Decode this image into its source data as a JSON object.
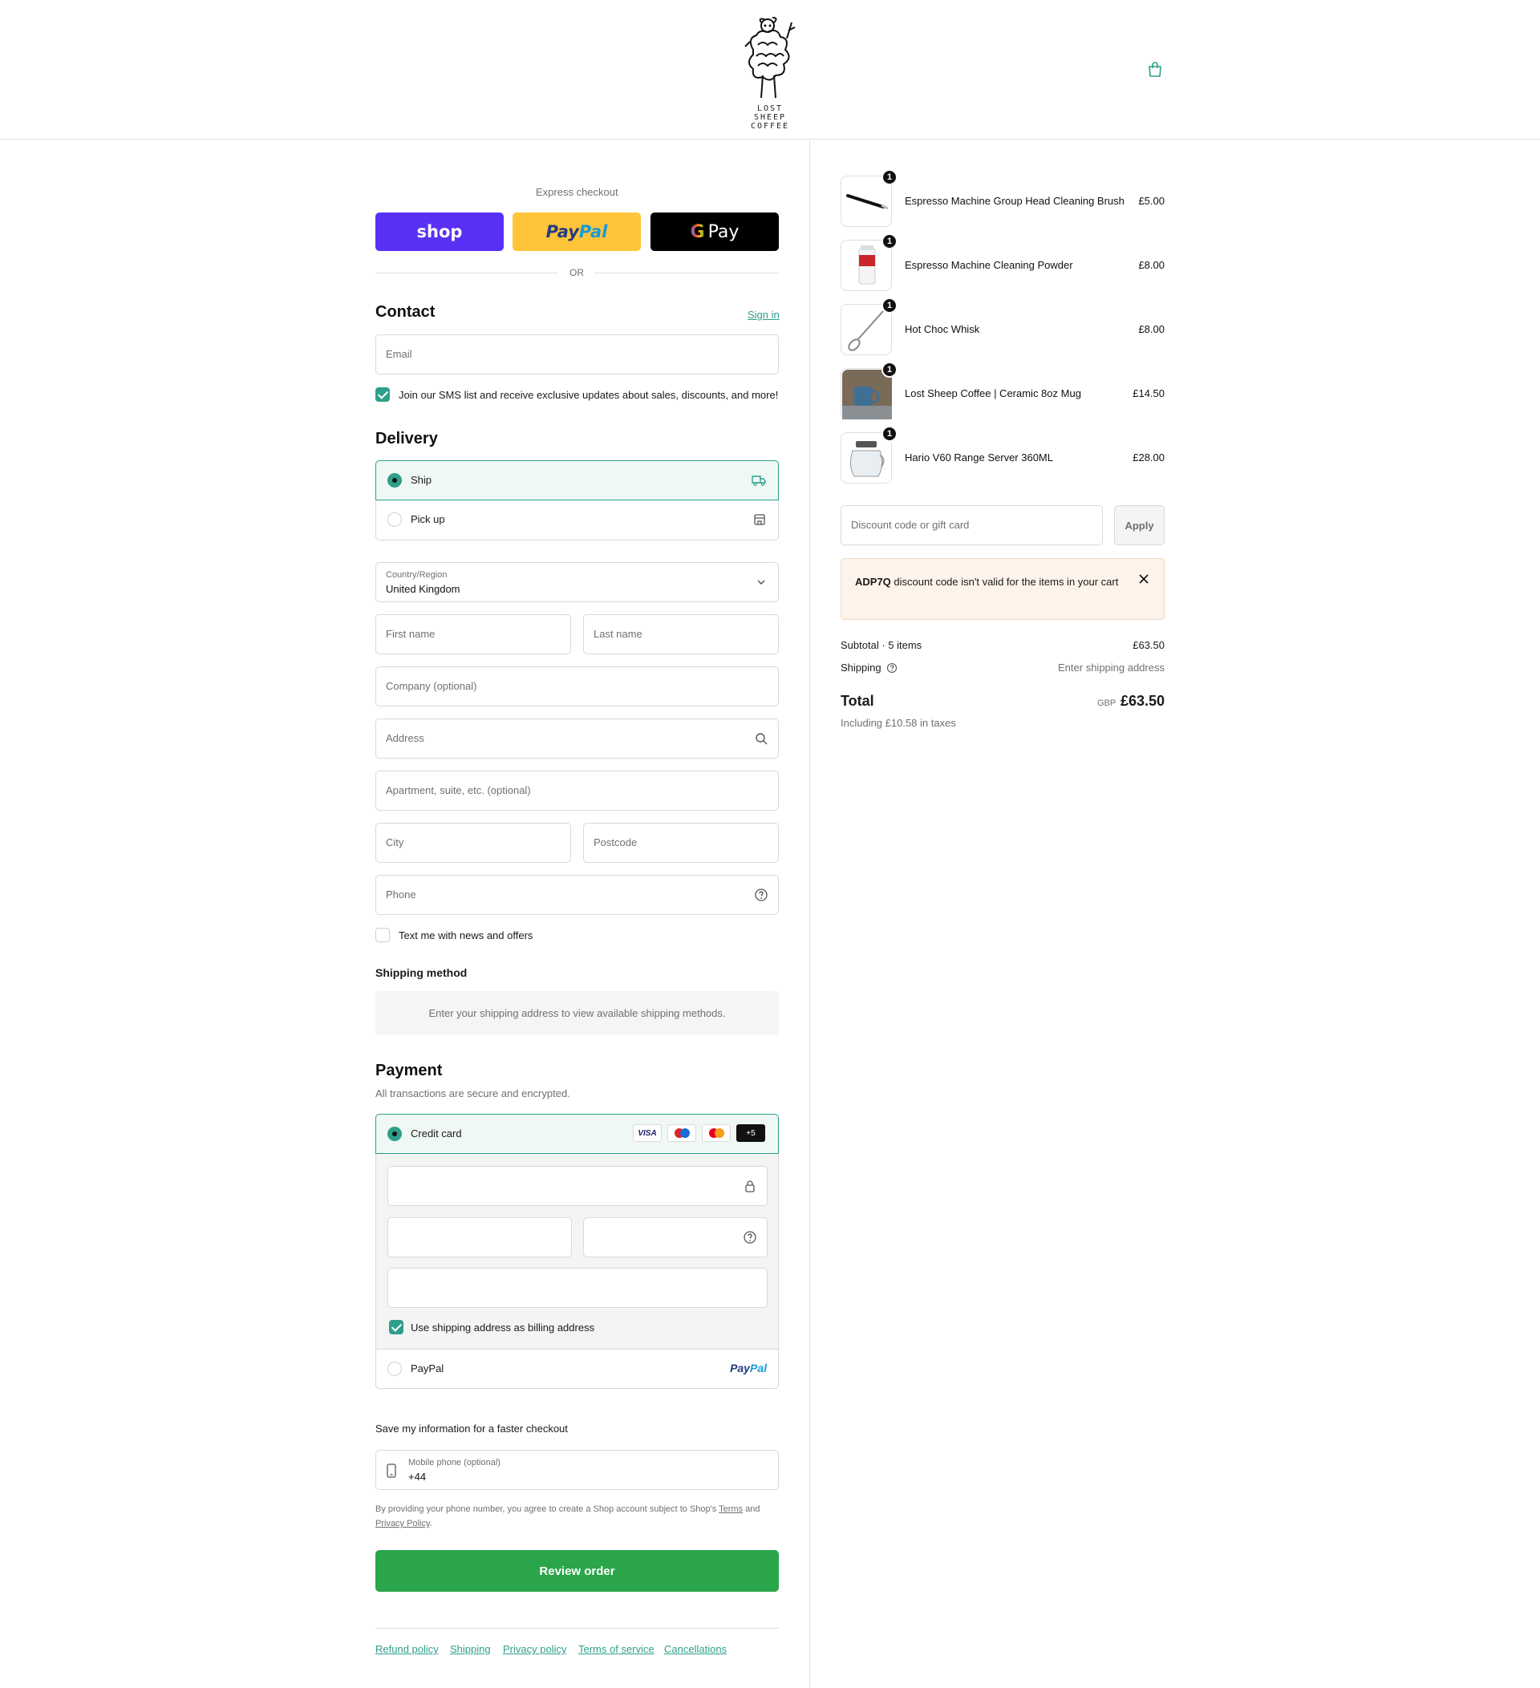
{
  "brand": {
    "logo_line1": "LOST SHEEP",
    "logo_line2": "COFFEE"
  },
  "express": {
    "title": "Express checkout",
    "shop_label": "shop",
    "paypal_part1": "Pay",
    "paypal_part2": "Pal",
    "gpay_label": "Pay",
    "or_label": "OR"
  },
  "contact": {
    "heading": "Contact",
    "sign_in": "Sign in",
    "email_placeholder": "Email",
    "sms_label": "Join our SMS list and receive exclusive updates about sales, discounts, and more!"
  },
  "delivery": {
    "heading": "Delivery",
    "ship_label": "Ship",
    "pickup_label": "Pick up",
    "country_label": "Country/Region",
    "country_value": "United Kingdom",
    "first_name": "First name",
    "last_name": "Last name",
    "company": "Company (optional)",
    "address": "Address",
    "apartment": "Apartment, suite, etc. (optional)",
    "city": "City",
    "postcode": "Postcode",
    "phone": "Phone",
    "text_offers": "Text me with news and offers"
  },
  "shipping_method": {
    "heading": "Shipping method",
    "notice": "Enter your shipping address to view available shipping methods."
  },
  "payment": {
    "heading": "Payment",
    "subtitle": "All transactions are secure and encrypted.",
    "credit_card_label": "Credit card",
    "card_logos": [
      "VISA",
      "maestro",
      "mastercard",
      "+5"
    ],
    "billing_label": "Use shipping address as billing address",
    "paypal_label": "PayPal",
    "paypal_logo_1": "Pay",
    "paypal_logo_2": "Pal"
  },
  "save_info": {
    "title": "Save my information for a faster checkout",
    "mobile_label": "Mobile phone (optional)",
    "mobile_value": "+44",
    "legal_prefix": "By providing your phone number, you agree to create a Shop account subject to Shop's ",
    "terms": "Terms",
    "legal_and": " and",
    "privacy": "Privacy Policy",
    "legal_suffix": "."
  },
  "review_button": "Review order",
  "footer_links": [
    "Refund policy",
    "Shipping",
    "Privacy policy",
    "Terms of service",
    "Cancellations"
  ],
  "summary": {
    "items": [
      {
        "name": "Espresso Machine Group Head Cleaning Brush",
        "price": "£5.00",
        "qty": "1"
      },
      {
        "name": "Espresso Machine Cleaning Powder",
        "price": "£8.00",
        "qty": "1"
      },
      {
        "name": "Hot Choc Whisk",
        "price": "£8.00",
        "qty": "1"
      },
      {
        "name": "Lost Sheep Coffee | Ceramic 8oz Mug",
        "price": "£14.50",
        "qty": "1"
      },
      {
        "name": "Hario V60 Range Server 360ML",
        "price": "£28.00",
        "qty": "1"
      }
    ],
    "discount_placeholder": "Discount code or gift card",
    "apply_label": "Apply",
    "alert_code": "ADP7Q",
    "alert_text": " discount code isn't valid for the items in your cart",
    "subtotal_label": "Subtotal · 5 items",
    "subtotal_value": "£63.50",
    "shipping_label": "Shipping",
    "shipping_value": "Enter shipping address",
    "total_label": "Total",
    "currency": "GBP",
    "total_value": "£63.50",
    "taxes": "Including £10.58 in taxes"
  },
  "colors": {
    "accent": "#2d9f8b",
    "shop_purple": "#5a31f4",
    "paypal_yellow": "#ffc439",
    "review_green": "#2aa54a",
    "alert_bg": "#fdf3ea"
  }
}
